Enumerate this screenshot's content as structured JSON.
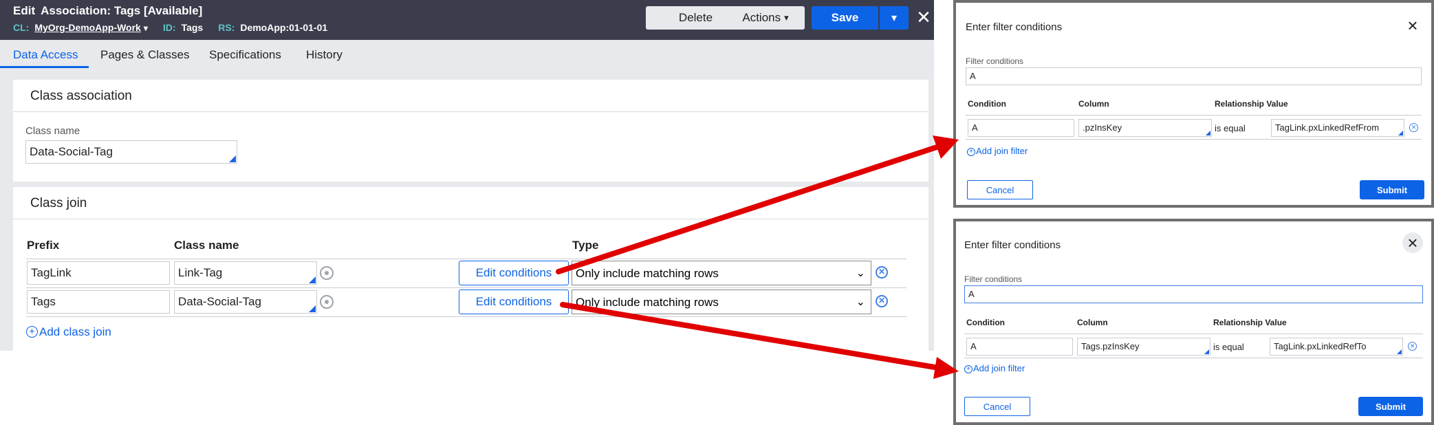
{
  "header": {
    "edit_label": "Edit",
    "title": "Association: Tags [Available]",
    "cl_label": "CL:",
    "cl_value": "MyOrg-DemoApp-Work",
    "id_label": "ID:",
    "id_value": "Tags",
    "rs_label": "RS:",
    "rs_value": "DemoApp:01-01-01",
    "delete_label": "Delete",
    "actions_label": "Actions",
    "save_label": "Save",
    "close_glyph": "✕"
  },
  "tabs": [
    {
      "label": "Data Access",
      "active": true
    },
    {
      "label": "Pages & Classes"
    },
    {
      "label": "Specifications"
    },
    {
      "label": "History"
    }
  ],
  "class_association": {
    "title": "Class association",
    "class_name_label": "Class name",
    "class_name_value": "Data-Social-Tag"
  },
  "class_join": {
    "title": "Class join",
    "headers": {
      "prefix": "Prefix",
      "class_name": "Class name",
      "type": "Type"
    },
    "rows": [
      {
        "prefix": "TagLink",
        "class_name": "Link-Tag",
        "edit_label": "Edit conditions",
        "type": "Only include matching rows"
      },
      {
        "prefix": "Tags",
        "class_name": "Data-Social-Tag",
        "edit_label": "Edit conditions",
        "type": "Only include matching rows"
      }
    ],
    "add_label": "Add class join"
  },
  "modals": [
    {
      "title": "Enter filter conditions",
      "filter_label": "Filter conditions",
      "filter_value": "A",
      "headers": {
        "condition": "Condition",
        "column": "Column",
        "relationship": "Relationship Value"
      },
      "row": {
        "condition": "A",
        "column": ".pzInsKey",
        "relationship": "is equal",
        "value": "TagLink.pxLinkedRefFrom"
      },
      "add_label": "Add join filter",
      "cancel_label": "Cancel",
      "submit_label": "Submit"
    },
    {
      "title": "Enter filter conditions",
      "filter_label": "Filter conditions",
      "filter_value": "A",
      "headers": {
        "condition": "Condition",
        "column": "Column",
        "relationship": "Relationship Value"
      },
      "row": {
        "condition": "A",
        "column": "Tags.pzInsKey",
        "relationship": "is equal",
        "value": "TagLink.pxLinkedRefTo"
      },
      "add_label": "Add join filter",
      "cancel_label": "Cancel",
      "submit_label": "Submit"
    }
  ],
  "colors": {
    "accent": "#0d63e6",
    "header_bg": "#3b3d4c",
    "meta_key": "#5fc3c9",
    "arrow": "#e00000"
  },
  "icons": [
    "chevron-down-icon",
    "close-icon",
    "gear-icon",
    "remove-circle-icon",
    "add-circle-icon",
    "arrow-annotation"
  ]
}
